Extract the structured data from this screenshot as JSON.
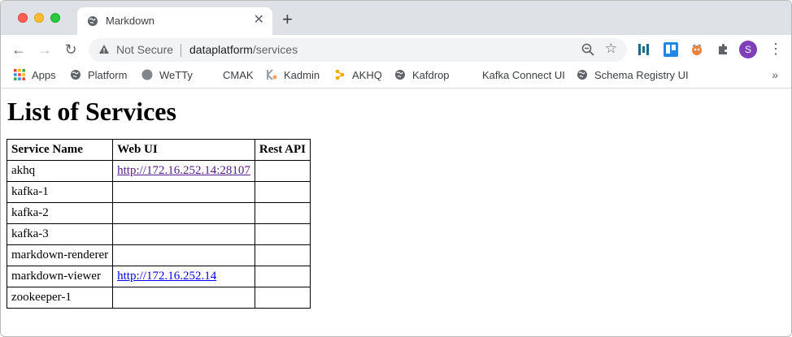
{
  "browser": {
    "tab_title": "Markdown",
    "not_secure_label": "Not Secure",
    "url_host": "dataplatform",
    "url_path": "/services",
    "avatar_initial": "S"
  },
  "bookmarks": [
    {
      "label": "Apps",
      "icon": "apps-grid-icon"
    },
    {
      "label": "Platform",
      "icon": "globe-icon"
    },
    {
      "label": "WeTTy",
      "icon": "circle-icon"
    },
    {
      "label": "CMAK",
      "icon": "none"
    },
    {
      "label": "Kadmin",
      "icon": "kadmin-icon"
    },
    {
      "label": "AKHQ",
      "icon": "akhq-icon"
    },
    {
      "label": "Kafdrop",
      "icon": "globe-icon"
    },
    {
      "label": "Kafka Connect UI",
      "icon": "none"
    },
    {
      "label": "Schema Registry UI",
      "icon": "globe-icon"
    }
  ],
  "bookmarks_more": "»",
  "page": {
    "title": "List of Services",
    "columns": [
      "Service Name",
      "Web UI",
      "Rest API"
    ],
    "rows": [
      {
        "name": "akhq",
        "web_ui": "http://172.16.252.14:28107",
        "rest_api": "",
        "visited": true
      },
      {
        "name": "kafka-1",
        "web_ui": "",
        "rest_api": ""
      },
      {
        "name": "kafka-2",
        "web_ui": "",
        "rest_api": ""
      },
      {
        "name": "kafka-3",
        "web_ui": "",
        "rest_api": ""
      },
      {
        "name": "markdown-renderer",
        "web_ui": "",
        "rest_api": ""
      },
      {
        "name": "markdown-viewer",
        "web_ui": "http://172.16.252.14",
        "rest_api": "",
        "visited": false
      },
      {
        "name": "zookeeper-1",
        "web_ui": "",
        "rest_api": ""
      }
    ]
  },
  "colors": {
    "link": "#0000ee",
    "visited_link": "#551a8b",
    "tabstrip": "#dee1e6",
    "avatar": "#7e3fb8"
  }
}
